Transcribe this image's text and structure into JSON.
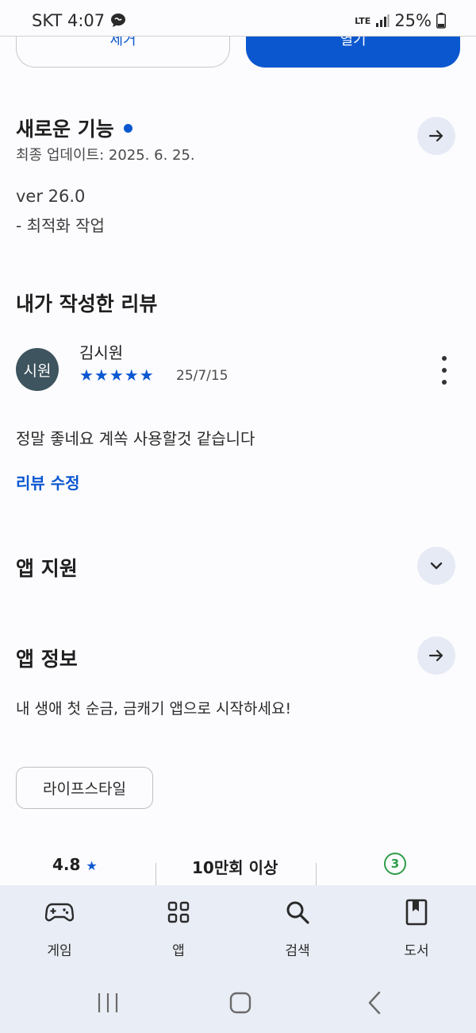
{
  "status_bar": {
    "carrier_time": "SKT 4:07",
    "network": "LTE",
    "battery": "25%"
  },
  "top_buttons": {
    "remove": "제거",
    "open": "열기"
  },
  "whats_new": {
    "title": "새로운 기능",
    "updated": "최종 업데이트: 2025. 6. 25.",
    "version": "ver 26.0",
    "notes": "- 최적화 작업"
  },
  "my_review": {
    "title": "내가 작성한 리뷰",
    "avatar_text": "시원",
    "reviewer": "김시원",
    "rating": 5,
    "stars": "★★★★★",
    "date": "25/7/15",
    "text": "정말 좋네요 계쏙 사용할것 같습니다",
    "edit_link": "리뷰 수정"
  },
  "app_support": {
    "title": "앱 지원"
  },
  "app_info": {
    "title": "앱 정보",
    "description": "내 생애 첫 순금, 금캐기 앱으로 시작하세요!",
    "category_chip": "라이프스타일"
  },
  "stats": {
    "rating": "4.8",
    "downloads": "10만회 이상",
    "age_rating": "3"
  },
  "bottom_nav": [
    {
      "label": "게임",
      "icon": "gamepad-icon"
    },
    {
      "label": "앱",
      "icon": "apps-grid-icon"
    },
    {
      "label": "검색",
      "icon": "search-icon"
    },
    {
      "label": "도서",
      "icon": "book-icon"
    }
  ],
  "colors": {
    "accent": "#0b57d0",
    "age_badge": "#2e9d4a",
    "avatar_bg": "#3e545e",
    "nav_bg": "#e9edf5"
  }
}
